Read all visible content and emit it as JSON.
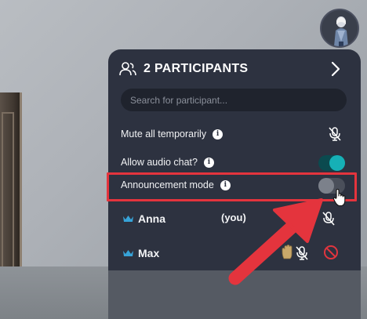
{
  "panel": {
    "title": "2 PARTICIPANTS",
    "search": {
      "placeholder": "Search for participant...",
      "value": ""
    }
  },
  "settings": [
    {
      "label": "Mute all temporarily",
      "info": "i",
      "control": "mic-off-icon"
    },
    {
      "label": "Allow audio chat?",
      "info": "i",
      "control": "toggle",
      "state": "on"
    },
    {
      "label": "Announcement mode",
      "info": "i",
      "control": "toggle",
      "state": "off"
    }
  ],
  "participants": [
    {
      "name": "Anna",
      "tag": "(you)",
      "icons": [
        "crown-icon",
        "mic-off-icon"
      ]
    },
    {
      "name": "Max",
      "tag": "",
      "icons": [
        "crown-icon",
        "raise-hand-icon",
        "mic-off-icon",
        "block-icon"
      ]
    }
  ],
  "colors": {
    "panel_bg": "#2d3240",
    "accent_teal": "#16b0b6",
    "crown_blue": "#37a3d8",
    "annotation_red": "#e4343d"
  }
}
